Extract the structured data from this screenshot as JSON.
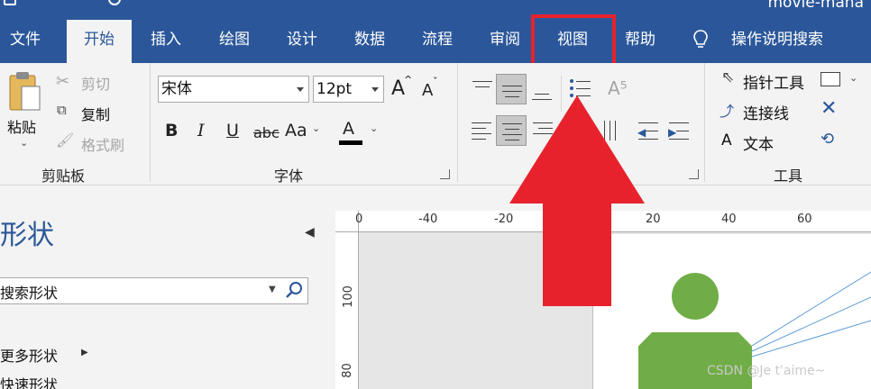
{
  "title_bar": {
    "title": "movie-mana"
  },
  "tabs": [
    {
      "label": "文件"
    },
    {
      "label": "开始"
    },
    {
      "label": "插入"
    },
    {
      "label": "绘图"
    },
    {
      "label": "设计"
    },
    {
      "label": "数据"
    },
    {
      "label": "流程"
    },
    {
      "label": "审阅"
    },
    {
      "label": "视图"
    },
    {
      "label": "帮助"
    }
  ],
  "tell_me": {
    "label": "操作说明搜索"
  },
  "clipboard": {
    "paste": "粘贴",
    "cut": "剪切",
    "copy": "复制",
    "format_painter": "格式刷",
    "group_label": "剪贴板"
  },
  "font": {
    "family": "宋体",
    "size": "12pt",
    "bold": "B",
    "italic": "I",
    "underline": "U",
    "strikethrough": "abc",
    "change_case": "Aa",
    "font_color": "A",
    "grow": "A",
    "shrink": "A",
    "group_label": "字体"
  },
  "tools": {
    "pointer": "指针工具",
    "connector": "连接线",
    "text": "文本",
    "text_glyph": "A",
    "group_label": "工具"
  },
  "shapes_pane": {
    "title": "形状",
    "search_placeholder": "搜索形状",
    "more_shapes": "更多形状",
    "quick_shapes": "快速形状"
  },
  "ruler": {
    "h_ticks": [
      "0",
      "-40",
      "-20",
      "0",
      "20",
      "40",
      "60"
    ],
    "v_ticks": [
      "100",
      "80"
    ]
  },
  "watermark": "CSDN @Je t'aime~",
  "colors": {
    "brand": "#2b579a",
    "shape_fill": "#70ad47",
    "highlight": "#e8222c"
  }
}
